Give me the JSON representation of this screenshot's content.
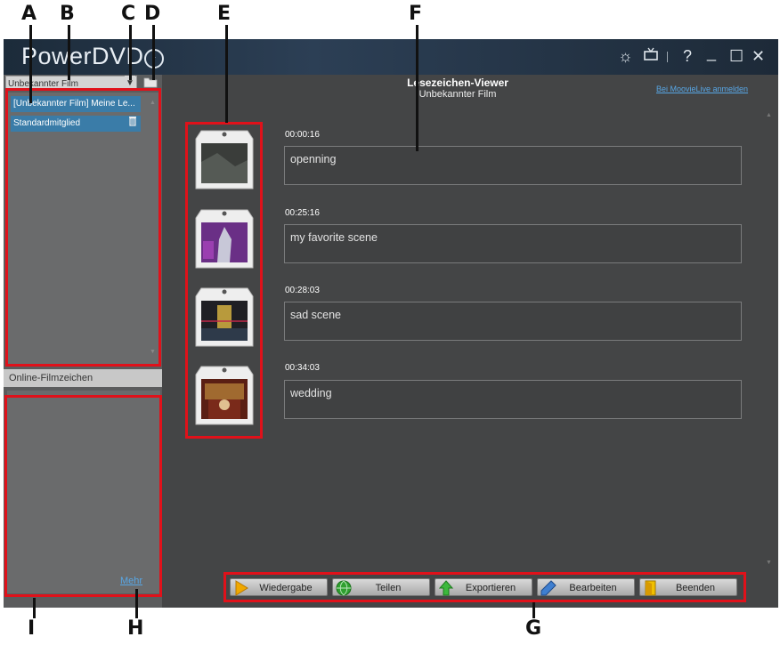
{
  "callouts": [
    "A",
    "B",
    "C",
    "D",
    "E",
    "F",
    "G",
    "H",
    "I"
  ],
  "titlebar": {
    "app_name": "PowerDVD",
    "icons": [
      "upgrade-arrow-icon",
      "gear-icon",
      "tv-icon",
      "help-icon",
      "minimize-icon",
      "maximize-icon",
      "close-icon"
    ],
    "help": "?",
    "minimize": "_",
    "maximize": "☐",
    "close": "✕"
  },
  "left": {
    "dropdown_value": "Unbekannter Film",
    "items": [
      {
        "label": "[Unbekannter Film] Meine Le..."
      },
      {
        "label": "Standardmitglied"
      }
    ],
    "online_header": "Online-Filmzeichen",
    "more_link": "Mehr"
  },
  "viewer": {
    "title": "Lesezeichen-Viewer",
    "subtitle": "Unbekannter Film",
    "login_link": "Bei MoovieLive anmelden"
  },
  "bookmarks": [
    {
      "time": "00:00:16",
      "note": "openning"
    },
    {
      "time": "00:25:16",
      "note": "my favorite scene"
    },
    {
      "time": "00:28:03",
      "note": "sad scene"
    },
    {
      "time": "00:34:03",
      "note": "wedding"
    }
  ],
  "buttons": [
    {
      "label": "Wiedergabe",
      "icon": "play-icon"
    },
    {
      "label": "Teilen",
      "icon": "globe-icon"
    },
    {
      "label": "Exportieren",
      "icon": "upload-arrow-icon"
    },
    {
      "label": "Bearbeiten",
      "icon": "pencil-icon"
    },
    {
      "label": "Beenden",
      "icon": "exit-door-icon"
    }
  ],
  "colors": {
    "highlight": "#e0111a",
    "accent": "#3a7ca8",
    "link": "#58a7e6"
  }
}
